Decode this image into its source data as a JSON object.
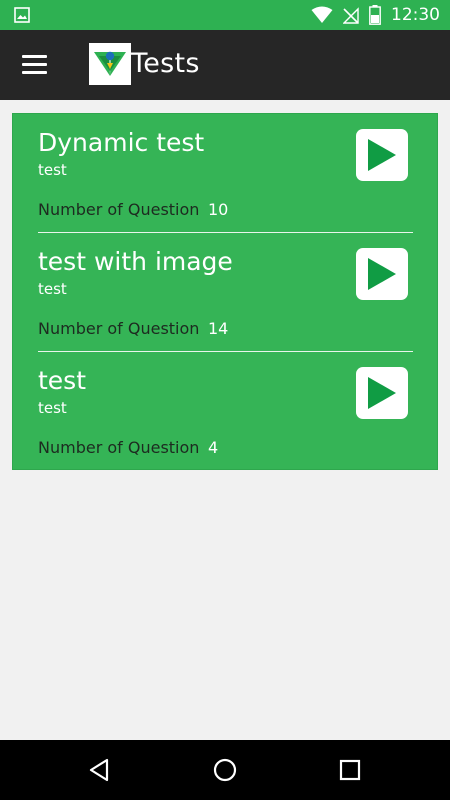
{
  "status_bar": {
    "time": "12:30",
    "icons": [
      "image-icon",
      "wifi-icon",
      "no-signal-icon",
      "battery-icon"
    ]
  },
  "app_bar": {
    "title": "Tests",
    "menu_icon": "menu-icon",
    "logo": "app-logo"
  },
  "tests": [
    {
      "name": "Dynamic test",
      "subtitle": "test",
      "count_label": "Number of Question",
      "count": "10"
    },
    {
      "name": "test with image",
      "subtitle": "test",
      "count_label": "Number of Question",
      "count": "14"
    },
    {
      "name": "test",
      "subtitle": "test",
      "count_label": "Number of Question",
      "count": "4"
    }
  ],
  "nav_bar": {
    "buttons": [
      "back-icon",
      "home-icon",
      "recents-icon"
    ]
  },
  "colors": {
    "status_bar": "#2eb152",
    "app_bar": "#262626",
    "card": "#35b456",
    "play_triangle": "#109c44",
    "background": "#f1f1f1"
  }
}
